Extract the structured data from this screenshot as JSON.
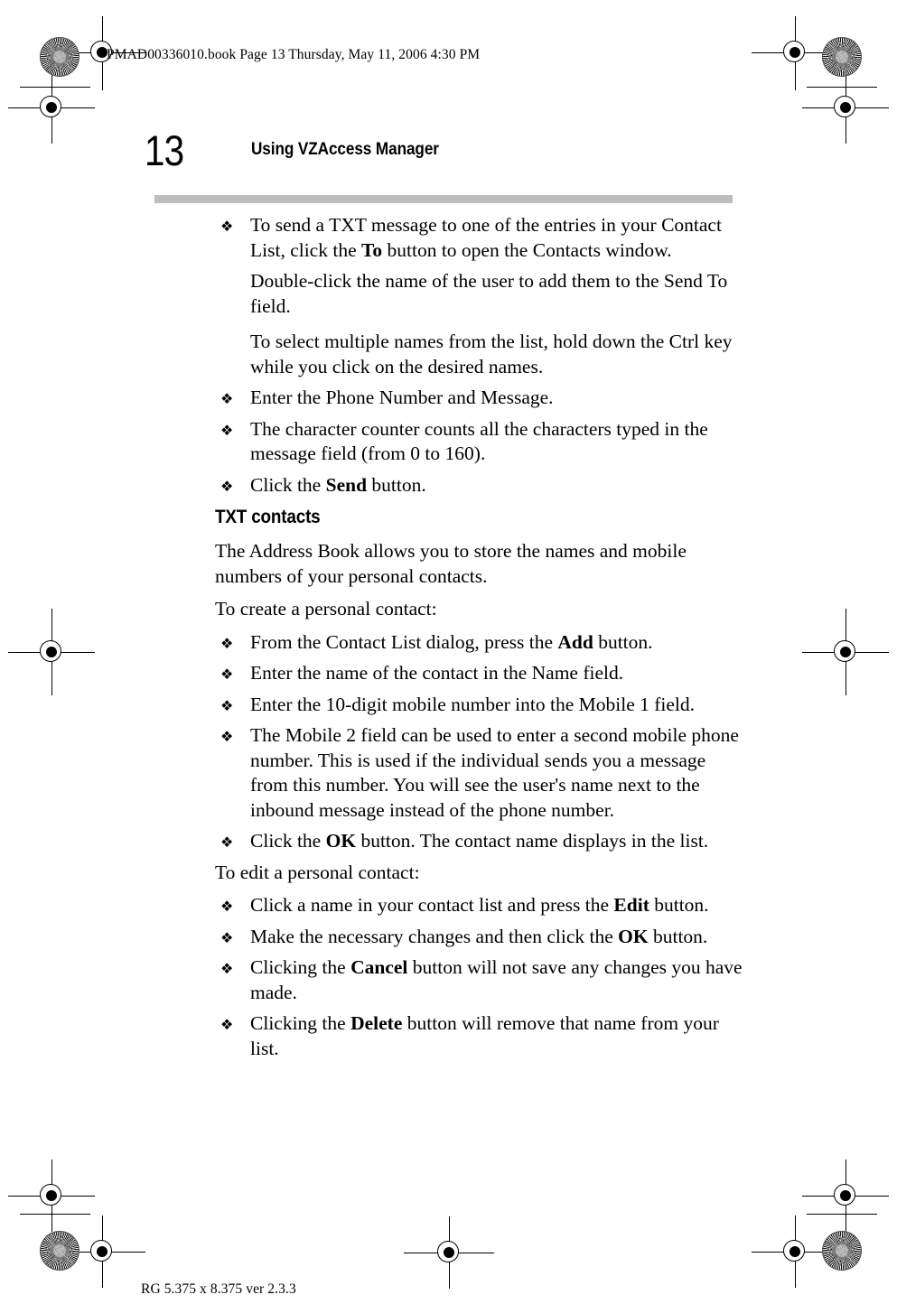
{
  "prepress": {
    "file_slug": "PMAD00336010.book  Page 13  Thursday, May 11, 2006  4:30 PM",
    "footer_slug": "RG 5.375 x 8.375 ver 2.3.3",
    "rule_color": "#bdbdbd"
  },
  "header": {
    "folio": "13",
    "chapter_title": "Using VZAccess Manager"
  },
  "content": {
    "blocks": [
      {
        "kind": "bullet",
        "bullet": "❖",
        "runs": [
          {
            "text": "To send a TXT message to one of the entries in your Contact List, click the "
          },
          {
            "text": "To",
            "bold": true
          },
          {
            "text": " button to open the Contacts window."
          }
        ]
      },
      {
        "kind": "subpara",
        "runs": [
          {
            "text": "Double-click the name of the user to add them to the Send To field."
          }
        ]
      },
      {
        "kind": "subpara",
        "gap": true,
        "runs": [
          {
            "text": "To select multiple names from the list, hold down the Ctrl key while you click on the desired names."
          }
        ]
      },
      {
        "kind": "bullet",
        "bullet": "❖",
        "runs": [
          {
            "text": "Enter the Phone Number and Message."
          }
        ]
      },
      {
        "kind": "bullet",
        "bullet": "❖",
        "runs": [
          {
            "text": "The character counter counts all the characters typed in the message field (from 0 to 160)."
          }
        ]
      },
      {
        "kind": "bullet",
        "bullet": "❖",
        "runs": [
          {
            "text": "Click the "
          },
          {
            "text": "Send",
            "bold": true
          },
          {
            "text": " button."
          }
        ]
      },
      {
        "kind": "heading",
        "runs": [
          {
            "text": "TXT contacts"
          }
        ]
      },
      {
        "kind": "para",
        "runs": [
          {
            "text": "The Address Book allows you to store the names and mobile numbers of your personal contacts."
          }
        ]
      },
      {
        "kind": "para",
        "runs": [
          {
            "text": "To create a personal contact:"
          }
        ]
      },
      {
        "kind": "bullet",
        "bullet": "❖",
        "runs": [
          {
            "text": "From the Contact List dialog, press the "
          },
          {
            "text": "Add",
            "bold": true
          },
          {
            "text": " button."
          }
        ]
      },
      {
        "kind": "bullet",
        "bullet": "❖",
        "runs": [
          {
            "text": "Enter the name of the contact in the Name field."
          }
        ]
      },
      {
        "kind": "bullet",
        "bullet": "❖",
        "runs": [
          {
            "text": "Enter the 10-digit mobile number into the Mobile 1 field."
          }
        ]
      },
      {
        "kind": "bullet",
        "bullet": "❖",
        "runs": [
          {
            "text": "The Mobile 2 field can be used to enter a second mobile phone number. This is used if the individual sends you a message from this number. You will see the user's name next to the inbound message instead of the phone number."
          }
        ]
      },
      {
        "kind": "bullet",
        "bullet": "❖",
        "runs": [
          {
            "text": "Click the "
          },
          {
            "text": "OK",
            "bold": true
          },
          {
            "text": " button. The contact name displays in the list."
          }
        ]
      },
      {
        "kind": "para",
        "runs": [
          {
            "text": "To edit a personal contact:"
          }
        ]
      },
      {
        "kind": "bullet",
        "bullet": "❖",
        "runs": [
          {
            "text": "Click a name in your contact list and press the "
          },
          {
            "text": "Edit",
            "bold": true
          },
          {
            "text": " button."
          }
        ]
      },
      {
        "kind": "bullet",
        "bullet": "❖",
        "runs": [
          {
            "text": "Make the necessary changes and then click the "
          },
          {
            "text": "OK",
            "bold": true
          },
          {
            "text": " button."
          }
        ]
      },
      {
        "kind": "bullet",
        "bullet": "❖",
        "runs": [
          {
            "text": "Clicking the "
          },
          {
            "text": "Cancel",
            "bold": true
          },
          {
            "text": " button will not save any changes you have made."
          }
        ]
      },
      {
        "kind": "bullet",
        "bullet": "❖",
        "runs": [
          {
            "text": "Clicking the "
          },
          {
            "text": "Delete",
            "bold": true
          },
          {
            "text": " button will remove that name from your list."
          }
        ]
      }
    ]
  }
}
